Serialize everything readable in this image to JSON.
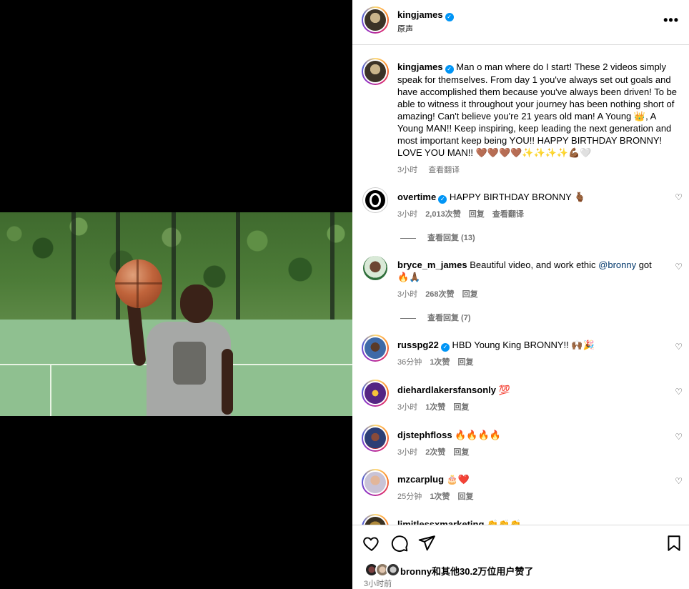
{
  "post": {
    "author": "kingjames",
    "audio": "原声",
    "caption": "Man o man where do I start! These 2 videos simply speak for themselves. From day 1 you've always set out goals and have accomplished them because you've always been driven! To be able to witness it throughout your journey has been nothing short of amazing! Can't believe you're 21 years old man! A Young 👑, A Young MAN!! Keep inspiring, keep leading the next generation and most important keep being YOU!! HAPPY BIRTHDAY BRONNY! LOVE YOU MAN!! 🤎🤎🤎🤎✨✨✨✨💪🏾🤍",
    "caption_time": "3小时",
    "translate": "查看翻译"
  },
  "comments": [
    {
      "user": "overtime",
      "verified": true,
      "text": "HAPPY BIRTHDAY BRONNY 🫰🏾",
      "time": "3小时",
      "likes": "2,013次赞",
      "reply": "回复",
      "translate": "查看翻译",
      "view_replies": "查看回复 (13)"
    },
    {
      "user": "bryce_m_james",
      "verified": false,
      "text_before": "Beautiful video, and work ethic ",
      "mention": "@bronny",
      "text_after": " got 🔥🙏🏾",
      "time": "3小时",
      "likes": "268次赞",
      "reply": "回复",
      "view_replies": "查看回复 (7)"
    },
    {
      "user": "russpg22",
      "verified": true,
      "text": "HBD Young King BRONNY!! 🙌🏾🎉",
      "time": "36分钟",
      "likes": "1次赞",
      "reply": "回复"
    },
    {
      "user": "diehardlakersfansonly",
      "verified": false,
      "text": "💯",
      "time": "3小时",
      "likes": "1次赞",
      "reply": "回复"
    },
    {
      "user": "djstephfloss",
      "verified": false,
      "text": "🔥🔥🔥🔥",
      "time": "3小时",
      "likes": "2次赞",
      "reply": "回复"
    },
    {
      "user": "mzcarplug",
      "verified": false,
      "text": "🎂❤️",
      "time": "25分钟",
      "likes": "1次赞",
      "reply": "回复"
    },
    {
      "user": "limitlessxmarketing",
      "verified": false,
      "text": "👏👏👏",
      "time": "",
      "likes": "",
      "reply": ""
    }
  ],
  "footer": {
    "liked_by": "bronny和其他30.2万位用户赞了",
    "time": "3小时前"
  },
  "icons": {
    "like": "heart-outline-icon",
    "comment": "speech-bubble-icon",
    "share": "paper-plane-icon",
    "save": "bookmark-icon",
    "more": "ellipsis-icon",
    "verified": "verified-badge-icon"
  }
}
